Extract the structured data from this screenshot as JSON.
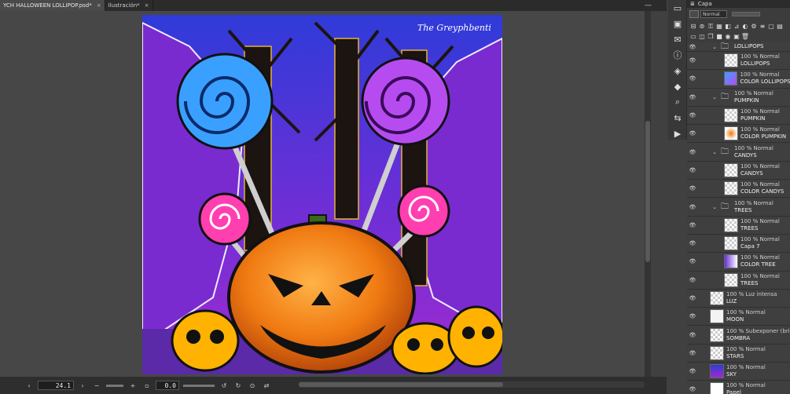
{
  "tabs": [
    {
      "label": "YCH HALLOWEEN LOLLIPOP.psd*",
      "active": true
    },
    {
      "label": "Ilustración*",
      "active": false
    }
  ],
  "bottombar": {
    "zoom": "24.1",
    "angle": "0.0"
  },
  "panel": {
    "title": "Capa",
    "blend_mode": "Normal"
  },
  "icons": {
    "strip": [
      "navigator-icon",
      "subview-icon",
      "material-icon",
      "info-icon",
      "layer-property-icon",
      "3d-icon",
      "search-layer-icon",
      "history-icon",
      "animation-icon"
    ]
  },
  "layers": [
    {
      "mode": "",
      "name": "LOLLIPOPS",
      "kind": "folder",
      "indent": 1,
      "partial": true
    },
    {
      "mode": "100 % Normal",
      "name": "LOLLIPOPS",
      "kind": "raster",
      "indent": 2,
      "thumb": "lollipops"
    },
    {
      "mode": "100 % Normal",
      "name": "COLOR LOLLIPOPS",
      "kind": "raster",
      "indent": 2,
      "thumb": "color-lollipops"
    },
    {
      "mode": "100 % Normal",
      "name": "PUMPKIN",
      "kind": "folder",
      "indent": 1
    },
    {
      "mode": "100 % Normal",
      "name": "PUMPKIN",
      "kind": "raster",
      "indent": 2,
      "thumb": "pumpkin"
    },
    {
      "mode": "100 % Normal",
      "name": "COLOR PUMPKIN",
      "kind": "raster",
      "indent": 2,
      "thumb": "color-pumpkin"
    },
    {
      "mode": "100 % Normal",
      "name": "CANDYS",
      "kind": "folder",
      "indent": 1
    },
    {
      "mode": "100 % Normal",
      "name": "CANDYS",
      "kind": "raster",
      "indent": 2,
      "thumb": "candys"
    },
    {
      "mode": "100 % Normal",
      "name": "COLOR CANDYS",
      "kind": "raster",
      "indent": 2,
      "thumb": "color-candys"
    },
    {
      "mode": "100 % Normal",
      "name": "TREES",
      "kind": "folder",
      "indent": 1
    },
    {
      "mode": "100 % Normal",
      "name": "TREES",
      "kind": "raster",
      "indent": 2,
      "thumb": "trees"
    },
    {
      "mode": "100 % Normal",
      "name": "Capa 7",
      "kind": "raster",
      "indent": 2,
      "thumb": "capa7"
    },
    {
      "mode": "100 % Normal",
      "name": "COLOR TREE",
      "kind": "raster",
      "indent": 2,
      "thumb": "color-tree"
    },
    {
      "mode": "100 % Normal",
      "name": "TREES",
      "kind": "raster",
      "indent": 2,
      "thumb": "trees2"
    },
    {
      "mode": "100 % Luz intensa",
      "name": "LUZ",
      "kind": "raster",
      "indent": 0,
      "thumb": "luz"
    },
    {
      "mode": "100 % Normal",
      "name": "MOON",
      "kind": "raster",
      "indent": 0,
      "thumb": "moon"
    },
    {
      "mode": "100 % Subexponer (bri",
      "name": "SOMBRA",
      "kind": "raster",
      "indent": 0,
      "thumb": "sombra"
    },
    {
      "mode": "100 % Normal",
      "name": "STARS",
      "kind": "raster",
      "indent": 0,
      "thumb": "stars"
    },
    {
      "mode": "100 % Normal",
      "name": "SKY",
      "kind": "raster",
      "indent": 0,
      "thumb": "sky"
    },
    {
      "mode": "100 % Normal",
      "name": "Papel",
      "kind": "raster",
      "indent": 0,
      "thumb": "papel"
    }
  ],
  "colors": {
    "sky_top": "#3b3fd6",
    "sky_bottom": "#8a2bd8",
    "pumpkin": "#f07a12",
    "lollipop_blue": "#3aa0ff",
    "lollipop_purple": "#b64cf0",
    "lollipop_pink": "#ff3fb0",
    "panel_bg": "#3c3c3c"
  }
}
